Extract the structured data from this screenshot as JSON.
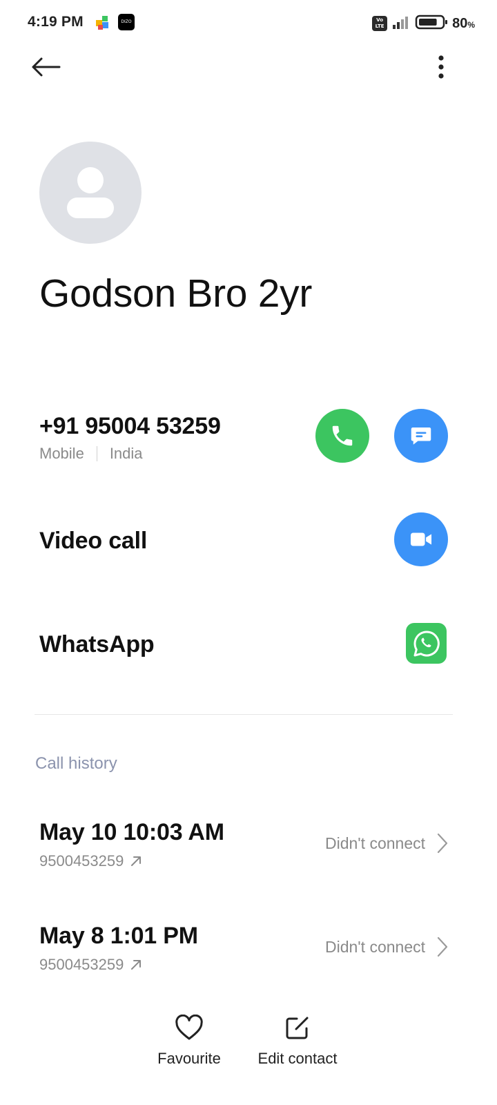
{
  "status_bar": {
    "time": "4:19 PM",
    "dizo_badge": "DIZO",
    "volte_badge": "Vo LTE",
    "battery_percent": "80",
    "battery_unit": "%",
    "battery_level": 0.8
  },
  "icons": {
    "back": "arrow-left-icon",
    "more": "more-vertical-icon",
    "avatar": "person-placeholder-icon",
    "call": "phone-icon",
    "message": "message-icon",
    "video": "video-camera-icon",
    "whatsapp": "whatsapp-icon",
    "outgoing": "arrow-up-right-icon",
    "chevron": "chevron-right-icon",
    "favourite": "heart-outline-icon",
    "edit": "edit-square-icon"
  },
  "contact": {
    "name": "Godson Bro 2yr",
    "phone": {
      "number": "+91 95004 53259",
      "type": "Mobile",
      "region": "India"
    },
    "video_call_label": "Video call",
    "whatsapp_label": "WhatsApp"
  },
  "call_history": {
    "header": "Call history",
    "items": [
      {
        "date": "May 10 10:03 AM",
        "number": "9500453259",
        "status": "Didn't connect"
      },
      {
        "date": "May 8 1:01 PM",
        "number": "9500453259",
        "status": "Didn't connect"
      }
    ]
  },
  "bottom_bar": {
    "favourite_label": "Favourite",
    "edit_label": "Edit contact"
  },
  "colors": {
    "call_green": "#3cc560",
    "action_blue": "#3b93f8",
    "avatar_gray": "#dfe1e6",
    "section_header": "#8b93ad",
    "secondary_text": "#8a8a8a"
  }
}
